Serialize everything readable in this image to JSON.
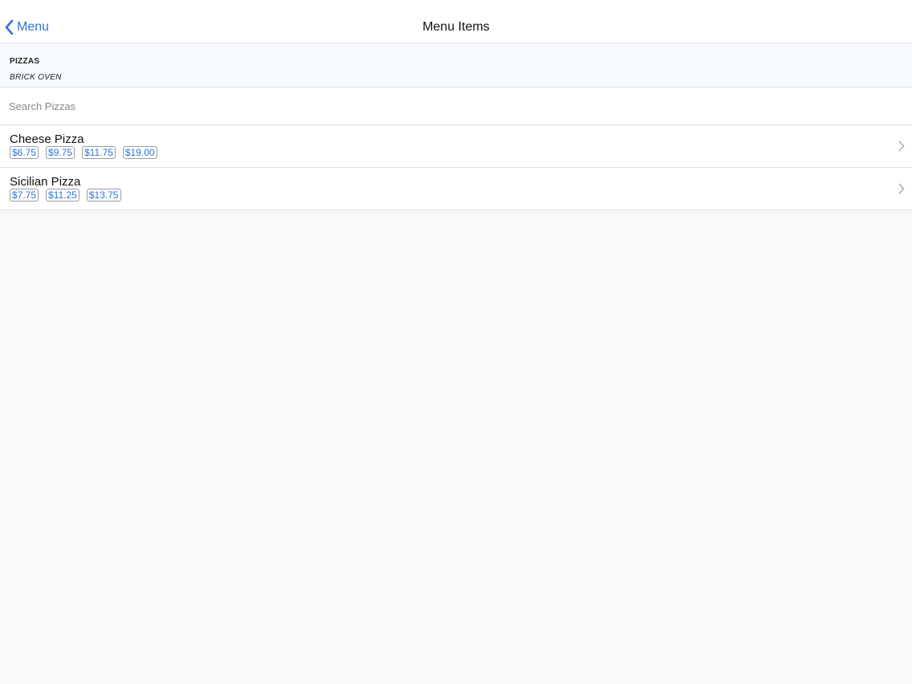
{
  "navbar": {
    "back_label": "Menu",
    "back_icon": "chevron-left-icon",
    "title": "Menu Items"
  },
  "section": {
    "title": "PIZZAS",
    "subtitle": "BRICK OVEN"
  },
  "search": {
    "placeholder": "Search Pizzas",
    "value": ""
  },
  "items": [
    {
      "name": "Cheese Pizza",
      "prices": [
        "$6.75",
        "$9.75",
        "$11.75",
        "$19.00"
      ]
    },
    {
      "name": "Sicilian Pizza",
      "prices": [
        "$7.75",
        "$11.25",
        "$13.75"
      ]
    }
  ],
  "colors": {
    "accent": "#2f73d9",
    "background": "#f8f8fa",
    "section_background": "#f7fafd"
  }
}
